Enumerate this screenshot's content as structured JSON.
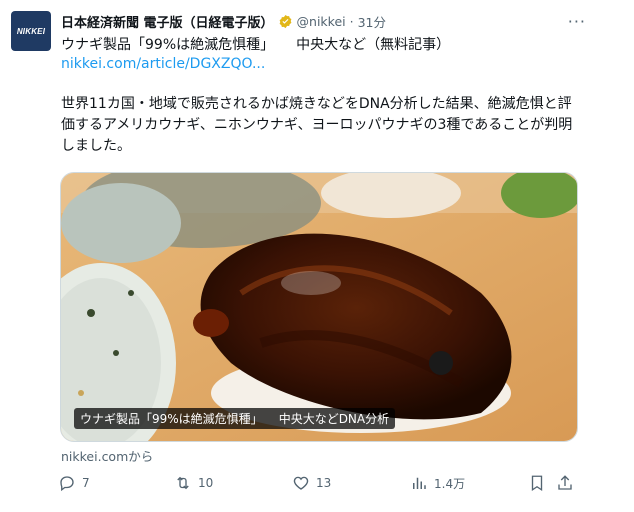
{
  "account": {
    "avatar_text": "NIKKEI",
    "name": "日本経済新聞 電子版（日経電子版）",
    "handle": "@nikkei",
    "separator": "·",
    "time": "31分",
    "more_label": "···"
  },
  "tweet": {
    "headline_part1": "ウナギ製品「99%は絶滅危惧種」",
    "headline_part2": "中央大など（無料記事）",
    "link": "nikkei.com/article/DGXZQO...",
    "body": "世界11カ国・地域で販売されるかば焼きなどをDNA分析した結果、絶滅危惧と評価するアメリカウナギ、ニホンウナギ、ヨーロッパウナギの3種であることが判明しました。",
    "media_caption_part1": "ウナギ製品「99%は絶滅危惧種」",
    "media_caption_part2": "中央大などDNA分析",
    "source": "nikkei.comから"
  },
  "actions": {
    "replies": "7",
    "retweets": "10",
    "likes": "13",
    "views": "1.4万"
  },
  "icons": {
    "verified": "verified-badge-icon",
    "reply": "reply-icon",
    "retweet": "retweet-icon",
    "like": "heart-icon",
    "views": "views-icon",
    "bookmark": "bookmark-icon",
    "share": "share-icon"
  },
  "colors": {
    "link": "#1d9bf0",
    "verified": "#e2b719",
    "muted": "#536471"
  }
}
